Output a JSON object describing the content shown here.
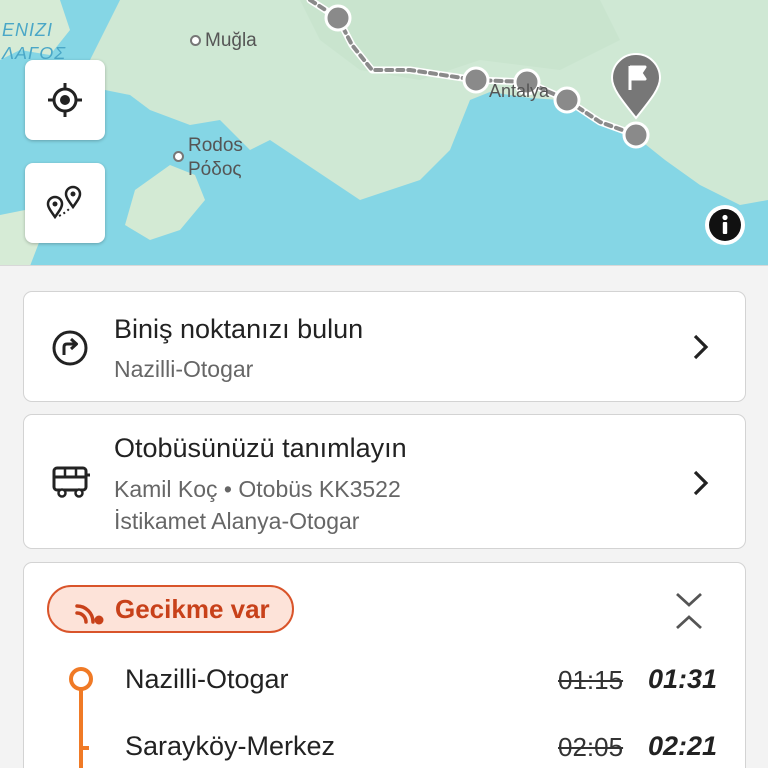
{
  "map": {
    "labels": {
      "sea_line1": "ENIZI",
      "sea_line2": "ΛΑΓΟΣ",
      "mugla": "Muğla",
      "rodos": "Rodos",
      "rodos_greek": "Ρόδος",
      "antalya": "Antalya"
    },
    "icons": {
      "locate": "crosshair-icon",
      "stops": "map-pins-icon",
      "info": "info-icon",
      "destination": "flag-pin-icon"
    }
  },
  "boarding_card": {
    "title": "Biniş noktanızı bulun",
    "subtitle": "Nazilli-Otogar"
  },
  "bus_card": {
    "title": "Otobüsünüzü tanımlayın",
    "operator_line": "Kamil Koç • Otobüs KK3522",
    "direction": "İstikamet Alanya-Otogar"
  },
  "schedule": {
    "status_label": "Gecikme var",
    "stops": [
      {
        "name": "Nazilli-Otogar",
        "scheduled": "01:15",
        "actual": "01:31"
      },
      {
        "name": "Sarayköy-Merkez",
        "scheduled": "02:05",
        "actual": "02:21"
      }
    ]
  },
  "colors": {
    "accent_orange": "#f07a26",
    "delay_red": "#c8411a",
    "sea": "#85d6e5",
    "land": "#cfe8d4"
  }
}
